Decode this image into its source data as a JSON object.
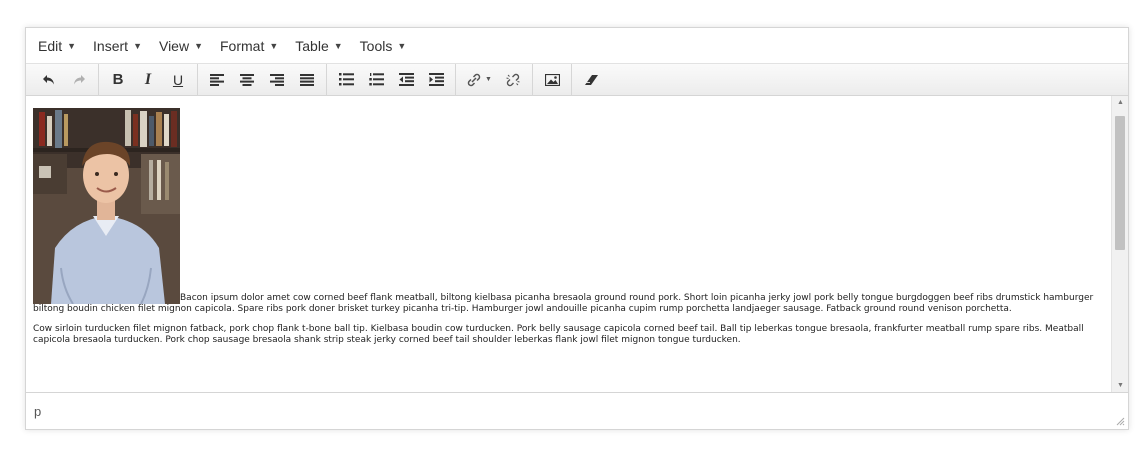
{
  "menubar": {
    "items": [
      {
        "label": "Edit"
      },
      {
        "label": "Insert"
      },
      {
        "label": "View"
      },
      {
        "label": "Format"
      },
      {
        "label": "Table"
      },
      {
        "label": "Tools"
      }
    ]
  },
  "toolbar": {
    "bold": "B",
    "italic": "I",
    "underline": "U",
    "icons": [
      "undo-icon",
      "redo-icon",
      "bold-icon",
      "italic-icon",
      "underline-icon",
      "align-left-icon",
      "align-center-icon",
      "align-right-icon",
      "align-justify-icon",
      "bullet-list-icon",
      "numbered-list-icon",
      "outdent-icon",
      "indent-icon",
      "link-icon",
      "unlink-icon",
      "image-icon",
      "eraser-icon"
    ]
  },
  "content": {
    "paragraph1": "Bacon ipsum dolor amet cow corned beef flank meatball, biltong kielbasa picanha bresaola ground round pork. Short loin picanha jerky jowl pork belly tongue burgdoggen beef ribs drumstick hamburger biltong boudin chicken filet mignon capicola. Spare ribs pork doner brisket turkey picanha tri-tip. Hamburger jowl andouille picanha cupim rump porchetta landjaeger sausage. Fatback ground round venison porchetta.",
    "paragraph2": "Cow sirloin turducken filet mignon fatback, pork chop flank t-bone ball tip. Kielbasa boudin cow turducken. Pork belly sausage capicola corned beef tail. Ball tip leberkas tongue bresaola, frankfurter meatball rump spare ribs. Meatball capicola bresaola turducken. Pork chop sausage bresaola shank strip steak jerky corned beef tail shoulder leberkas flank jowl filet mignon tongue turducken."
  },
  "statusbar": {
    "path": "p"
  },
  "colors": {
    "border": "#d5d5d5",
    "toolbar_bg": "#f0f0f0",
    "text": "#333333"
  }
}
